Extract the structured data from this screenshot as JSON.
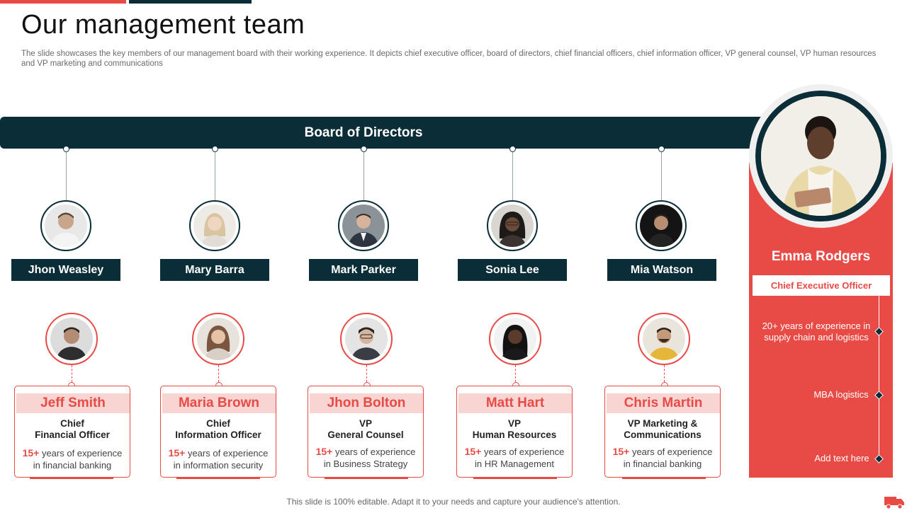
{
  "header": {
    "title": "Our management team",
    "subtitle": "The slide showcases the key members of our management board with their working experience. It depicts chief executive officer, board of directors, chief financial officers, chief information officer, VP general counsel, VP human resources and VP marketing and communications"
  },
  "board": {
    "label": "Board of Directors",
    "members": [
      {
        "name": "Jhon Weasley"
      },
      {
        "name": "Mary Barra"
      },
      {
        "name": "Mark Parker"
      },
      {
        "name": "Sonia Lee"
      },
      {
        "name": "Mia Watson"
      }
    ]
  },
  "officers": [
    {
      "name": "Jeff Smith",
      "role_line1": "Chief",
      "role_line2": "Financial Officer",
      "exp_highlight": "15+",
      "exp_text1": " years of experience",
      "exp_text2": "in financial banking"
    },
    {
      "name": "Maria Brown",
      "role_line1": "Chief",
      "role_line2": "Information Officer",
      "exp_highlight": "15+",
      "exp_text1": " years of experience",
      "exp_text2": "in information security"
    },
    {
      "name": "Jhon Bolton",
      "role_line1": "VP",
      "role_line2": "General Counsel",
      "exp_highlight": "15+",
      "exp_text1": " years of experience",
      "exp_text2": "in Business Strategy"
    },
    {
      "name": "Matt Hart",
      "role_line1": "VP",
      "role_line2": "Human Resources",
      "exp_highlight": "15+",
      "exp_text1": " years of experience",
      "exp_text2": "in HR Management"
    },
    {
      "name": "Chris Martin",
      "role_line1": "VP Marketing &",
      "role_line2": "Communications",
      "exp_highlight": "15+",
      "exp_text1": " years of experience",
      "exp_text2": "in financial banking"
    }
  ],
  "ceo": {
    "name": "Emma Rodgers",
    "title": "Chief Executive  Officer",
    "point1_line1": "20+ years of experience in",
    "point1_line2": "supply chain and logistics",
    "point2": "MBA logistics",
    "point3": "Add text here"
  },
  "footer": {
    "text": "This slide is 100% editable. Adapt it to your needs and capture your audience's attention."
  },
  "colors": {
    "accent_red": "#e84b46",
    "dark_teal": "#0a2d38",
    "light_pink": "#f8d4d3"
  },
  "icons": [
    "person-photo",
    "truck-icon"
  ]
}
